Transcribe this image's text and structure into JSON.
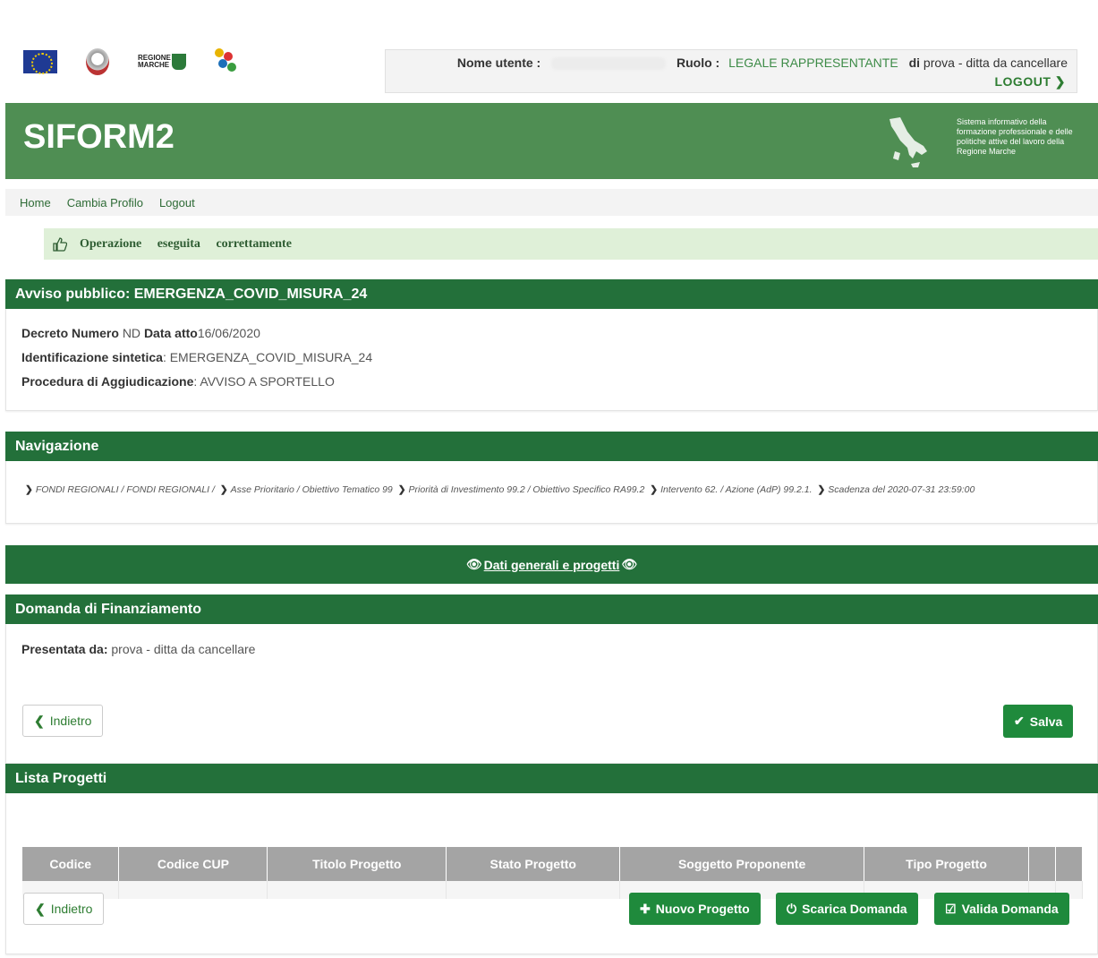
{
  "header": {
    "user_label": "Nome utente :",
    "role_label": "Ruolo :",
    "role_value": "LEGALE RAPPRESENTANTE",
    "of_label": "di",
    "company": "prova - ditta da cancellare",
    "logout": "LOGOUT"
  },
  "logos": {
    "regione_text": "REGIONE MARCHE"
  },
  "banner": {
    "title": "SIFORM2",
    "description": "Sistema informativo della formazione professionale e delle politiche attive del lavoro della Regione Marche"
  },
  "nav": {
    "items": [
      "Home",
      "Cambia Profilo",
      "Logout"
    ]
  },
  "alert": {
    "words": [
      "Operazione",
      "eseguita",
      "correttamente"
    ]
  },
  "avviso": {
    "title": "Avviso pubblico: EMERGENZA_COVID_MISURA_24",
    "decreto_label": "Decreto Numero",
    "decreto_value": "ND",
    "data_label": "Data atto",
    "data_value": "16/06/2020",
    "id_label": "Identificazione sintetica",
    "id_value": ": EMERGENZA_COVID_MISURA_24",
    "proc_label": "Procedura di Aggiudicazione",
    "proc_value": ": AVVISO A SPORTELLO"
  },
  "navigazione": {
    "title": "Navigazione",
    "crumbs": [
      "FONDI REGIONALI / FONDI REGIONALI /",
      "Asse Prioritario / Obiettivo Tematico 99",
      "Priorità di Investimento 99.2 / Obiettivo Specifico RA99.2",
      "Intervento 62. / Azione (AdP) 99.2.1.",
      "Scadenza del 2020-07-31 23:59:00"
    ]
  },
  "dati": {
    "label": "Dati generali e progetti"
  },
  "domanda": {
    "title": "Domanda di Finanziamento",
    "presentata_label": "Presentata da:",
    "presentata_value": "prova - ditta da cancellare",
    "back_label": "Indietro",
    "save_label": "Salva"
  },
  "progetti": {
    "title": "Lista Progetti",
    "columns": [
      "Codice",
      "Codice CUP",
      "Titolo Progetto",
      "Stato Progetto",
      "Soggetto Proponente",
      "Tipo Progetto",
      "",
      ""
    ],
    "back_label": "Indietro",
    "new_label": "Nuovo Progetto",
    "download_label": "Scarica Domanda",
    "validate_label": "Valida Domanda"
  },
  "colors": {
    "primary_green": "#23703a",
    "banner_green": "#4f8e53",
    "button_green": "#1f8a3c",
    "alert_bg": "#dff0d8"
  }
}
